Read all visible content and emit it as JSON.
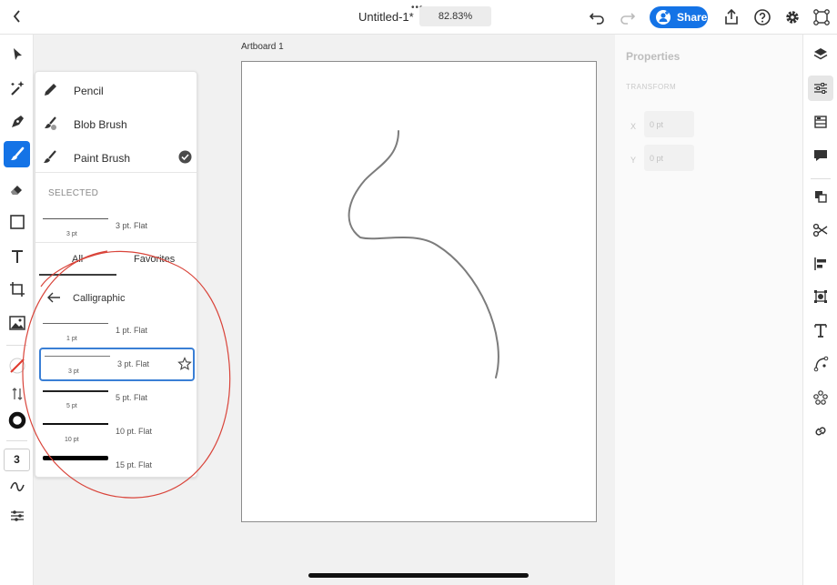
{
  "document": {
    "title": "Untitled-1*",
    "zoom": "82.83%",
    "more_icon": "ellipsis-icon"
  },
  "topbar": {
    "share_label": "Share"
  },
  "tool_panel": {
    "brush_types": [
      {
        "label": "Pencil",
        "icon": "pencil-icon",
        "selected": false
      },
      {
        "label": "Blob Brush",
        "icon": "blob-brush-icon",
        "selected": false
      },
      {
        "label": "Paint Brush",
        "icon": "paint-brush-icon",
        "selected": true
      }
    ],
    "selected_section": "SELECTED",
    "selected_brush": {
      "size": "3 pt",
      "name": "3 pt. Flat"
    },
    "tabs": [
      "All",
      "Favorites"
    ],
    "category": "Calligraphic",
    "brushes": [
      {
        "size": "1 pt",
        "name": "1 pt. Flat",
        "highlighted": false
      },
      {
        "size": "3 pt",
        "name": "3 pt. Flat",
        "highlighted": true
      },
      {
        "size": "5 pt",
        "name": "5 pt. Flat",
        "highlighted": false
      },
      {
        "size": "10 pt",
        "name": "10 pt. Flat",
        "highlighted": false
      },
      {
        "size": "",
        "name": "15 pt. Flat",
        "highlighted": false
      }
    ]
  },
  "left_toolbar": {
    "stroke_weight": "3"
  },
  "canvas": {
    "artboard_label": "Artboard 1"
  },
  "properties": {
    "title": "Properties",
    "section": "TRANSFORM",
    "x_label": "X",
    "x_value": "0 pt",
    "y_label": "Y",
    "y_value": "0 pt"
  },
  "colors": {
    "accent": "#1473e6",
    "annotation": "#d9443a",
    "stroke_color": "#e03a2e"
  }
}
